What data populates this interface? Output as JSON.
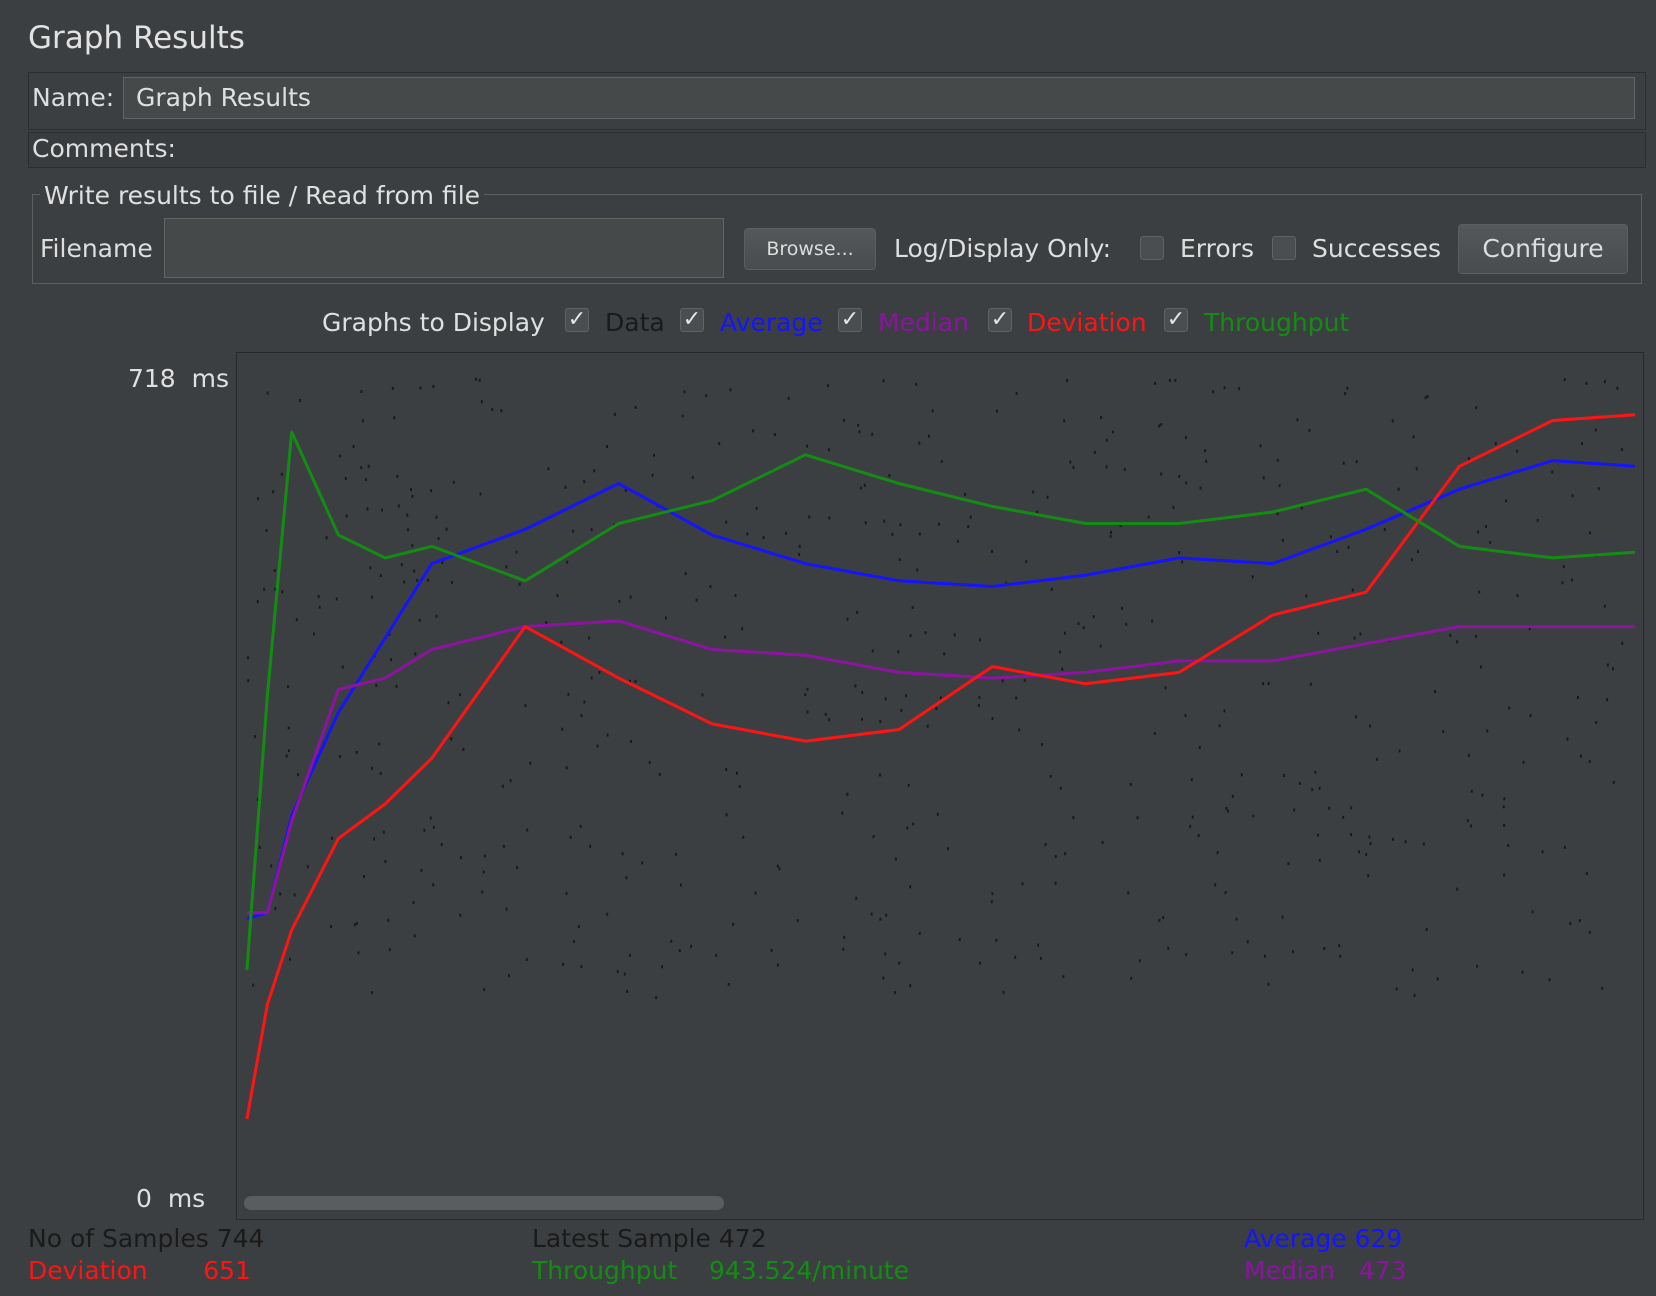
{
  "panel_title": "Graph Results",
  "name_label": "Name:",
  "name_value": "Graph Results",
  "comments_label": "Comments:",
  "file_section": {
    "legend": "Write results to file / Read from file",
    "filename_label": "Filename",
    "filename_value": "",
    "browse_label": "Browse...",
    "log_display_label": "Log/Display Only:",
    "errors_label": "Errors",
    "errors_checked": false,
    "successes_label": "Successes",
    "successes_checked": false,
    "configure_label": "Configure"
  },
  "graphs_to_display": {
    "label": "Graphs to Display",
    "options": [
      {
        "label": "Data",
        "checked": true,
        "color": "#1a1a1a"
      },
      {
        "label": "Average",
        "checked": true,
        "color": "#1414ff"
      },
      {
        "label": "Median",
        "checked": true,
        "color": "#8c14a0"
      },
      {
        "label": "Deviation",
        "checked": true,
        "color": "#ff1414"
      },
      {
        "label": "Throughput",
        "checked": true,
        "color": "#148c14"
      }
    ]
  },
  "y_axis": {
    "max_label": "718",
    "min_label": "0",
    "unit": "ms"
  },
  "stats": {
    "samples_label": "No of Samples",
    "samples_value": "744",
    "latest_label": "Latest Sample",
    "latest_value": "472",
    "average_label": "Average",
    "average_value": "629",
    "deviation_label": "Deviation",
    "deviation_value": "651",
    "throughput_label": "Throughput",
    "throughput_value": "943.524/minute",
    "median_label": "Median",
    "median_value": "473"
  },
  "colors": {
    "data": "#1a1a1a",
    "average": "#1414ff",
    "median": "#8c14a0",
    "deviation": "#ff1414",
    "throughput": "#148c14"
  },
  "chart_data": {
    "type": "line",
    "ylim": [
      0,
      718
    ],
    "x": [
      1,
      12,
      25,
      50,
      75,
      100,
      150,
      200,
      250,
      300,
      350,
      400,
      450,
      500,
      550,
      600,
      650,
      700,
      744
    ],
    "series": [
      {
        "name": "Average",
        "values": [
          245,
          250,
          335,
          425,
          490,
          555,
          585,
          625,
          580,
          555,
          540,
          535,
          545,
          560,
          555,
          585,
          620,
          645,
          640
        ]
      },
      {
        "name": "Median",
        "values": [
          250,
          250,
          330,
          445,
          455,
          480,
          500,
          505,
          480,
          475,
          460,
          455,
          460,
          470,
          470,
          485,
          500,
          500,
          500
        ]
      },
      {
        "name": "Deviation",
        "values": [
          70,
          170,
          235,
          315,
          345,
          385,
          500,
          455,
          415,
          400,
          410,
          465,
          450,
          460,
          510,
          530,
          640,
          680,
          685
        ]
      },
      {
        "name": "Throughput",
        "values": [
          200,
          440,
          670,
          580,
          560,
          570,
          540,
          590,
          610,
          650,
          625,
          605,
          590,
          590,
          600,
          620,
          570,
          560,
          565
        ]
      }
    ]
  }
}
